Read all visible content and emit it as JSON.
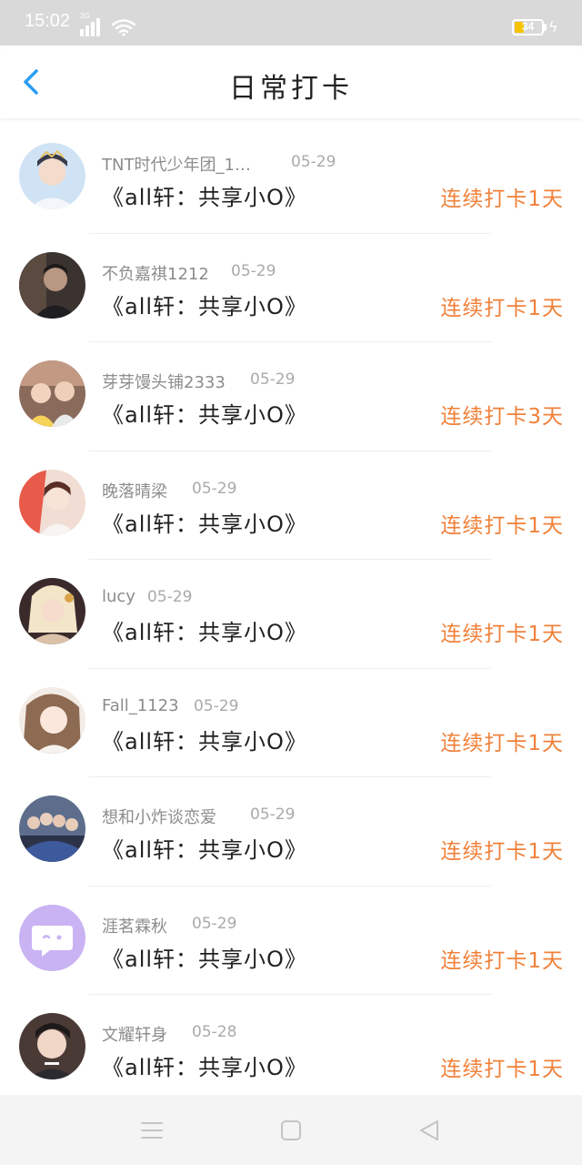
{
  "status_bar": {
    "time": "15:02",
    "network": "3G",
    "battery": "34",
    "battery_level": 0.34
  },
  "header": {
    "title": "日常打卡",
    "back_icon": "chevron-left-icon"
  },
  "checkins": [
    {
      "user": "TNT时代少年团_1…",
      "date": "05-29",
      "title": "《all轩：共享小O》",
      "streak": "连续打卡1天"
    },
    {
      "user": "不负嘉祺1212",
      "date": "05-29",
      "title": "《all轩：共享小O》",
      "streak": "连续打卡1天"
    },
    {
      "user": "芽芽馒头铺2333",
      "date": "05-29",
      "title": "《all轩：共享小O》",
      "streak": "连续打卡3天"
    },
    {
      "user": "晚落晴梁",
      "date": "05-29",
      "title": "《all轩：共享小O》",
      "streak": "连续打卡1天"
    },
    {
      "user": "lucy",
      "date": "05-29",
      "title": "《all轩：共享小O》",
      "streak": "连续打卡1天"
    },
    {
      "user": "Fall_1123",
      "date": "05-29",
      "title": "《all轩：共享小O》",
      "streak": "连续打卡1天"
    },
    {
      "user": "想和小炸谈恋爱",
      "date": "05-29",
      "title": "《all轩：共享小O》",
      "streak": "连续打卡1天"
    },
    {
      "user": "涯茗霖秋",
      "date": "05-29",
      "title": "《all轩：共享小O》",
      "streak": "连续打卡1天"
    },
    {
      "user": "文耀轩身",
      "date": "05-28",
      "title": "《all轩：共享小O》",
      "streak": "连续打卡1天"
    }
  ],
  "bottom_nav": {
    "icons": [
      "menu-icon",
      "home-square-icon",
      "back-triangle-icon"
    ]
  },
  "colors": {
    "accent": "#f0813a",
    "back": "#2a9df4",
    "status_bar": "#d9d9d9",
    "default_avatar": "#c9b3f3"
  }
}
